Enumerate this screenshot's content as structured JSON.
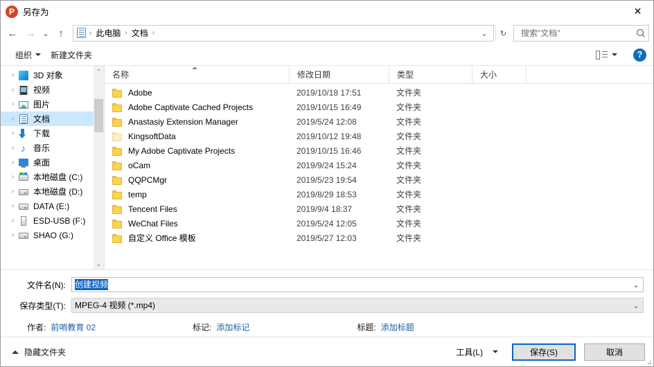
{
  "window": {
    "title": "另存为",
    "app_icon": "powerpoint-icon",
    "close_label": "✕",
    "accent_color": "#0a64c8",
    "selection_color": "#cce8ff",
    "app_icon_color": "#d24726"
  },
  "nav": {
    "back_label": "←",
    "forward_label": "→",
    "recent_label": "⌄",
    "up_label": "↑",
    "refresh_label": "↻",
    "address_dropdown_label": "⌄",
    "breadcrumbs": [
      {
        "label": "此电脑",
        "sep": "›"
      },
      {
        "label": "文档",
        "sep": "›"
      }
    ]
  },
  "search": {
    "placeholder": "搜索\"文档\"",
    "value": ""
  },
  "toolbar": {
    "organize_label": "组织",
    "new_folder_label": "新建文件夹",
    "view_dropdown_label": "▼",
    "help_label": "?"
  },
  "sidebar": {
    "items": [
      {
        "label": "3D 对象",
        "icon": "cube-icon",
        "icon_class": "ic-3d",
        "expander": "›",
        "selected": false
      },
      {
        "label": "视频",
        "icon": "video-icon",
        "icon_class": "ic-video",
        "expander": "›",
        "selected": false
      },
      {
        "label": "图片",
        "icon": "picture-icon",
        "icon_class": "ic-pic",
        "expander": "›",
        "selected": false
      },
      {
        "label": "文档",
        "icon": "documents-icon",
        "icon_class": "ic-doc",
        "expander": "›",
        "selected": true
      },
      {
        "label": "下载",
        "icon": "download-icon",
        "icon_class": "ic-dl",
        "expander": "›",
        "selected": false
      },
      {
        "label": "音乐",
        "icon": "music-icon",
        "icon_class": "ic-music",
        "expander": "›",
        "selected": false
      },
      {
        "label": "桌面",
        "icon": "desktop-icon",
        "icon_class": "ic-desk",
        "expander": "›",
        "selected": false
      },
      {
        "label": "本地磁盘 (C:)",
        "icon": "system-drive-icon",
        "icon_class": "ic-drivec",
        "expander": "›",
        "selected": false
      },
      {
        "label": "本地磁盘 (D:)",
        "icon": "drive-icon",
        "icon_class": "ic-drive",
        "expander": "›",
        "selected": false
      },
      {
        "label": "DATA (E:)",
        "icon": "drive-icon",
        "icon_class": "ic-drive",
        "expander": "›",
        "selected": false
      },
      {
        "label": "ESD-USB (F:)",
        "icon": "usb-drive-icon",
        "icon_class": "ic-usb",
        "expander": "›",
        "selected": false
      },
      {
        "label": "SHAO (G:)",
        "icon": "drive-icon",
        "icon_class": "ic-drive",
        "expander": "›",
        "selected": false
      }
    ],
    "scroll_up_label": "⌃",
    "scroll_down_label": "⌄"
  },
  "filelist": {
    "columns": [
      {
        "label": "名称",
        "sorted": true
      },
      {
        "label": "修改日期",
        "sorted": false
      },
      {
        "label": "类型",
        "sorted": false
      },
      {
        "label": "大小",
        "sorted": false
      }
    ],
    "rows": [
      {
        "name": "Adobe",
        "date": "2019/10/18 17:51",
        "type": "文件夹",
        "size": "",
        "icon": "folder-icon",
        "pale": false
      },
      {
        "name": "Adobe Captivate Cached Projects",
        "date": "2019/10/15 16:49",
        "type": "文件夹",
        "size": "",
        "icon": "folder-icon",
        "pale": false
      },
      {
        "name": "Anastasiy Extension Manager",
        "date": "2019/5/24 12:08",
        "type": "文件夹",
        "size": "",
        "icon": "folder-icon",
        "pale": false
      },
      {
        "name": "KingsoftData",
        "date": "2019/10/12 19:48",
        "type": "文件夹",
        "size": "",
        "icon": "folder-icon",
        "pale": true
      },
      {
        "name": "My Adobe Captivate Projects",
        "date": "2019/10/15 16:46",
        "type": "文件夹",
        "size": "",
        "icon": "folder-icon",
        "pale": false
      },
      {
        "name": "oCam",
        "date": "2019/9/24 15:24",
        "type": "文件夹",
        "size": "",
        "icon": "folder-icon",
        "pale": false
      },
      {
        "name": "QQPCMgr",
        "date": "2019/5/23 19:54",
        "type": "文件夹",
        "size": "",
        "icon": "folder-icon",
        "pale": false
      },
      {
        "name": "temp",
        "date": "2019/8/29 18:53",
        "type": "文件夹",
        "size": "",
        "icon": "folder-icon",
        "pale": false
      },
      {
        "name": "Tencent Files",
        "date": "2019/9/4 18:37",
        "type": "文件夹",
        "size": "",
        "icon": "folder-icon",
        "pale": false
      },
      {
        "name": "WeChat Files",
        "date": "2019/5/24 12:05",
        "type": "文件夹",
        "size": "",
        "icon": "folder-icon",
        "pale": false
      },
      {
        "name": "自定义 Office 模板",
        "date": "2019/5/27 12:03",
        "type": "文件夹",
        "size": "",
        "icon": "folder-icon",
        "pale": false
      }
    ]
  },
  "form": {
    "filename_label": "文件名(N):",
    "filename_value": "创建视频",
    "filename_selected": true,
    "filetype_label": "保存类型(T):",
    "filetype_value": "MPEG-4 视频 (*.mp4)",
    "dropdown_label": "⌄"
  },
  "meta": {
    "author_label": "作者:",
    "author_value": "前哨教育 02",
    "tags_label": "标记:",
    "tags_value": "添加标记",
    "title_label": "标题:",
    "title_value": "添加标题"
  },
  "footer": {
    "hide_folders_label": "隐藏文件夹",
    "tools_label": "工具(L)",
    "tools_caret": "▼",
    "save_label": "保存(S)",
    "cancel_label": "取消"
  }
}
